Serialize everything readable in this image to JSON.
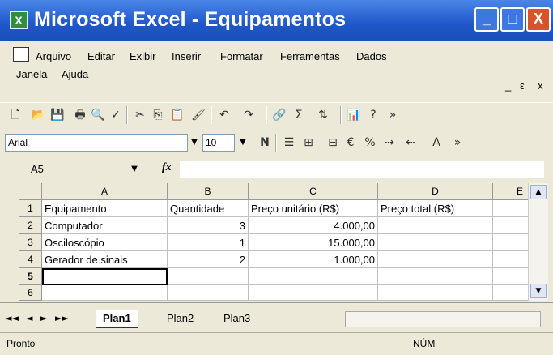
{
  "window": {
    "title": "Microsoft Excel - Equipamentos",
    "minimize_glyph": "_",
    "maximize_glyph": "□",
    "close_glyph": "X"
  },
  "menu": {
    "items": [
      "Arquivo",
      "Editar",
      "Exibir",
      "Inserir",
      "Formatar",
      "Ferramentas",
      "Dados",
      "Janela",
      "Ajuda"
    ],
    "mdi_min": "_",
    "mdi_restore": "ε",
    "mdi_close": "x"
  },
  "toolbar": {
    "font_name": "Arial",
    "font_size": "10",
    "bold_glyph": "N",
    "autosum_glyph": "Σ",
    "currency_glyph": "€",
    "percent_glyph": "%"
  },
  "formula_bar": {
    "name_box": "A5",
    "fx": "fx",
    "value": ""
  },
  "sheet": {
    "columns": [
      "A",
      "B",
      "C",
      "D",
      "E"
    ],
    "rows": [
      {
        "n": "1",
        "a": "Equipamento",
        "b": "Quantidade",
        "c": "Preço unitário (R$)",
        "d": "Preço total (R$)"
      },
      {
        "n": "2",
        "a": "Computador",
        "b": "3",
        "c": "4.000,00",
        "d": ""
      },
      {
        "n": "3",
        "a": "Osciloscópio",
        "b": "1",
        "c": "15.000,00",
        "d": ""
      },
      {
        "n": "4",
        "a": "Gerador de sinais",
        "b": "2",
        "c": "1.000,00",
        "d": ""
      },
      {
        "n": "5",
        "a": "",
        "b": "",
        "c": "",
        "d": ""
      },
      {
        "n": "6",
        "a": "",
        "b": "",
        "c": "",
        "d": ""
      }
    ],
    "active_cell": "A5"
  },
  "tabs": {
    "nav": [
      "◄◄",
      "◄",
      "►",
      "►►"
    ],
    "sheets": [
      "Plan1",
      "Plan2",
      "Plan3"
    ],
    "active": "Plan1"
  },
  "status": {
    "left": "Pronto",
    "right": "NÚM"
  }
}
